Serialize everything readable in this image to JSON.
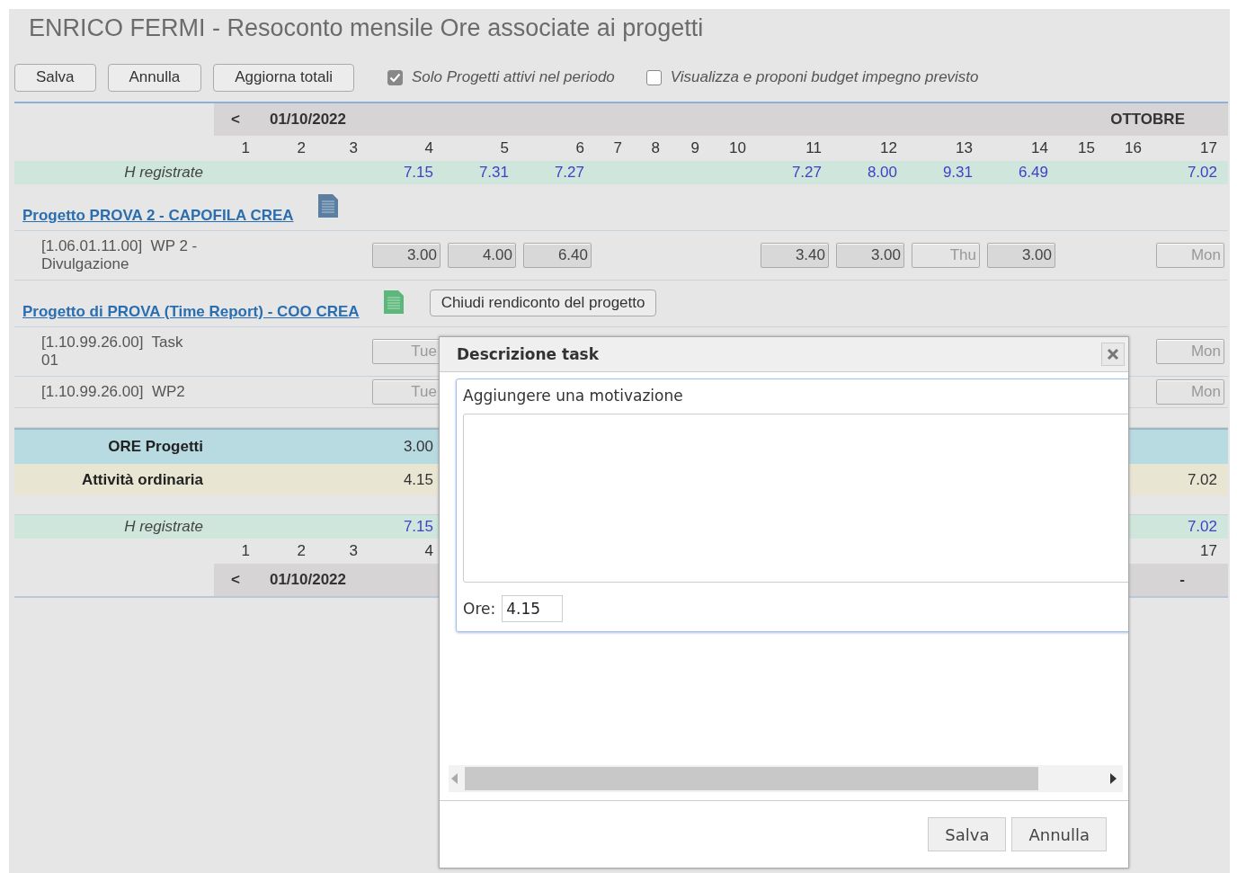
{
  "title": "ENRICO FERMI - Resoconto mensile Ore associate ai progetti",
  "toolbar": {
    "buttons": [
      "Salva",
      "Annulla",
      "Aggiorna totali"
    ],
    "checkboxes": [
      {
        "label": "Solo Progetti attivi nel periodo",
        "checked": true
      },
      {
        "label": "Visualizza e proponi budget impegno previsto",
        "checked": false
      }
    ]
  },
  "header": {
    "prev": "<",
    "date": "01/10/2022",
    "month": "OTTOBRE"
  },
  "days": [
    "1",
    "2",
    "3",
    "4",
    "5",
    "6",
    "7",
    "8",
    "9",
    "10",
    "11",
    "12",
    "13",
    "14",
    "15",
    "16",
    "17"
  ],
  "rows": [
    {
      "kind": "registered",
      "label": "H registrate",
      "cells": [
        {},
        {},
        {},
        {
          "text": "7.15"
        },
        {
          "text": "7.31"
        },
        {
          "text": "7.27"
        },
        {},
        {},
        {},
        {},
        {
          "text": "7.27"
        },
        {
          "text": "8.00"
        },
        {
          "text": "9.31"
        },
        {
          "text": "6.49"
        },
        {},
        {},
        {
          "text": "7.02"
        }
      ]
    },
    {
      "kind": "project",
      "label": "Progetto PROVA 2 - CAPOFILA CREA",
      "color": "#5a7fa0"
    },
    {
      "kind": "task",
      "label": "[1.06.01.11.00]  WP 2 - Divulgazione",
      "cells": [
        {},
        {},
        {},
        {
          "value": "3.00"
        },
        {
          "value": "4.00"
        },
        {
          "value": "6.40"
        },
        {},
        {},
        {},
        {},
        {
          "value": "3.40"
        },
        {
          "value": "3.00"
        },
        {
          "placeholder": "Thu"
        },
        {
          "value": "3.00"
        },
        {},
        {},
        {
          "placeholder": "Mon"
        }
      ]
    },
    {
      "kind": "project",
      "label": "Progetto di PROVA (Time Report) - COO CREA",
      "color": "#5cb87a",
      "button": "Chiudi rendiconto del progetto"
    },
    {
      "kind": "task",
      "label": "[1.10.99.26.00]  Task 01",
      "cells": [
        {},
        {},
        {},
        {
          "placeholder": "Tue"
        },
        {},
        {},
        {},
        {},
        {},
        {},
        {},
        {},
        {},
        {},
        {},
        {},
        {
          "placeholder": "Mon"
        }
      ]
    },
    {
      "kind": "task",
      "label": "[1.10.99.26.00]  WP2",
      "cells": [
        {},
        {},
        {},
        {
          "placeholder": "Tue"
        },
        {},
        {},
        {},
        {},
        {},
        {},
        {},
        {},
        {},
        {},
        {},
        {},
        {
          "placeholder": "Mon"
        }
      ]
    },
    {
      "kind": "spacer"
    },
    {
      "kind": "projects_total",
      "label": "ORE Progetti",
      "cells": [
        {},
        {},
        {},
        {
          "text": "3.00"
        }
      ]
    },
    {
      "kind": "ordinary",
      "label": "Attività ordinaria",
      "cells": [
        {},
        {},
        {},
        {
          "text": "4.15"
        },
        {},
        {},
        {},
        {},
        {},
        {},
        {},
        {},
        {},
        {},
        {},
        {},
        {
          "text": "7.02"
        }
      ]
    },
    {
      "kind": "spacer"
    },
    {
      "kind": "registered",
      "label": "H registrate",
      "cells": [
        {},
        {},
        {},
        {
          "text": "7.15"
        },
        {},
        {},
        {},
        {},
        {},
        {},
        {},
        {},
        {},
        {},
        {},
        {},
        {
          "text": "7.02"
        }
      ]
    }
  ],
  "footer": {
    "days_start": [
      "1",
      "2",
      "3",
      "4"
    ],
    "days_end": [
      "17"
    ],
    "prev": "<",
    "date": "01/10/2022",
    "trailing": "-"
  },
  "dialog": {
    "title": "Descrizione task",
    "label": "Aggiungere una motivazione",
    "hours_label": "Ore:",
    "hours_value": "4.15",
    "buttons": [
      "Salva",
      "Annulla"
    ]
  }
}
